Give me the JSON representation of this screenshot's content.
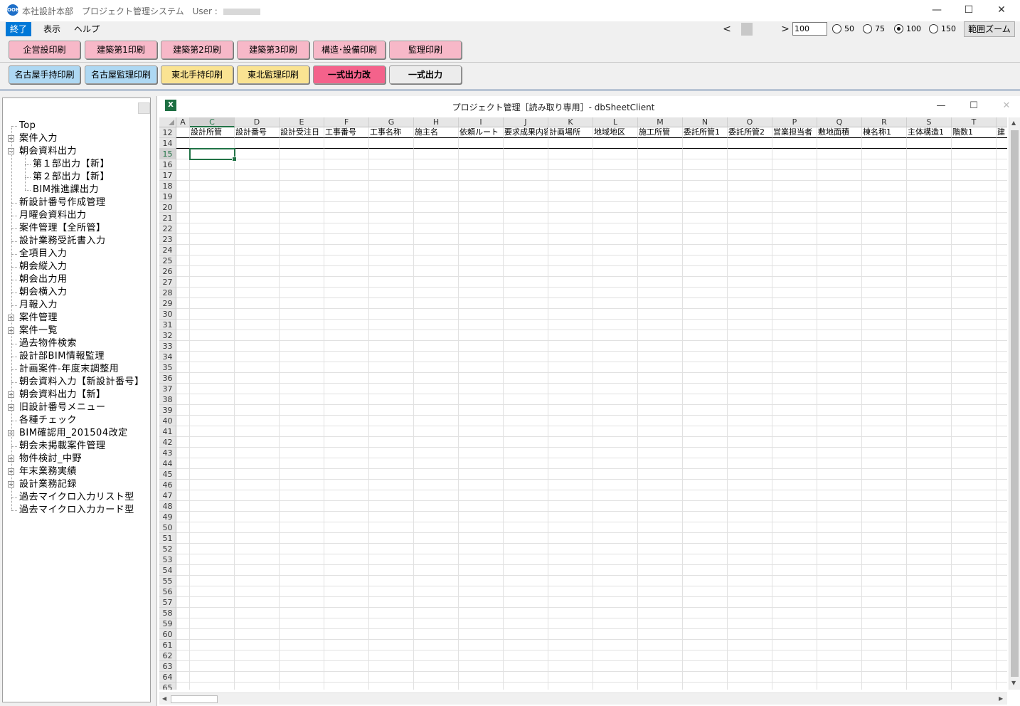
{
  "app": {
    "title_prefix": "本社設計本部　プロジェクト管理システム　User : ",
    "icon_text": "OOB"
  },
  "window_controls": {
    "minimize": "—",
    "maximize": "☐",
    "close": "✕"
  },
  "menu": [
    {
      "label": "終了",
      "active": true
    },
    {
      "label": "表示",
      "active": false
    },
    {
      "label": "ヘルプ",
      "active": false
    }
  ],
  "zoom": {
    "prev": "<",
    "next": ">",
    "value": "100",
    "options": [
      {
        "label": "50",
        "selected": false
      },
      {
        "label": "75",
        "selected": false
      },
      {
        "label": "100",
        "selected": true
      },
      {
        "label": "150",
        "selected": false
      }
    ],
    "range_zoom_label": "範囲ズーム"
  },
  "print_buttons": {
    "row1": [
      {
        "label": "企営設印刷",
        "color": "#f7b8c8"
      },
      {
        "label": "建築第1印刷",
        "color": "#f7b8c8"
      },
      {
        "label": "建築第2印刷",
        "color": "#f7b8c8"
      },
      {
        "label": "建築第3印刷",
        "color": "#f7b8c8"
      },
      {
        "label": "構造･設備印刷",
        "color": "#f7b8c8"
      },
      {
        "label": "監理印刷",
        "color": "#f7b8c8"
      }
    ],
    "row2": [
      {
        "label": "名古屋手持印刷",
        "color": "#aed8f3"
      },
      {
        "label": "名古屋監理印刷",
        "color": "#aed8f3"
      },
      {
        "label": "東北手持印刷",
        "color": "#fae392"
      },
      {
        "label": "東北監理印刷",
        "color": "#fae392"
      },
      {
        "label": "一式出力改",
        "color": "#f4628b"
      },
      {
        "label": "一式出力",
        "color": "#ececec"
      }
    ]
  },
  "tree": [
    {
      "label": "Top",
      "level": 0,
      "expander": "none"
    },
    {
      "label": "案件入力",
      "level": 0,
      "expander": "+"
    },
    {
      "label": "朝会資料出力",
      "level": 0,
      "expander": "-"
    },
    {
      "label": "第１部出力【新】",
      "level": 1,
      "expander": "none"
    },
    {
      "label": "第２部出力【新】",
      "level": 1,
      "expander": "none"
    },
    {
      "label": "BIM推進課出力",
      "level": 1,
      "expander": "none"
    },
    {
      "label": "新設計番号作成管理",
      "level": 0,
      "expander": "none"
    },
    {
      "label": "月曜会資料出力",
      "level": 0,
      "expander": "none"
    },
    {
      "label": "案件管理【全所管】",
      "level": 0,
      "expander": "none"
    },
    {
      "label": "設計業務受託書入力",
      "level": 0,
      "expander": "none"
    },
    {
      "label": "全項目入力",
      "level": 0,
      "expander": "none"
    },
    {
      "label": "朝会縦入力",
      "level": 0,
      "expander": "none"
    },
    {
      "label": "朝会出力用",
      "level": 0,
      "expander": "none"
    },
    {
      "label": "朝会横入力",
      "level": 0,
      "expander": "none"
    },
    {
      "label": "月報入力",
      "level": 0,
      "expander": "none"
    },
    {
      "label": "案件管理",
      "level": 0,
      "expander": "+"
    },
    {
      "label": "案件一覧",
      "level": 0,
      "expander": "+"
    },
    {
      "label": "過去物件検索",
      "level": 0,
      "expander": "none"
    },
    {
      "label": "設計部BIM情報監理",
      "level": 0,
      "expander": "none"
    },
    {
      "label": "計画案件-年度末調整用",
      "level": 0,
      "expander": "none"
    },
    {
      "label": "朝会資料入力【新設計番号】",
      "level": 0,
      "expander": "none"
    },
    {
      "label": "朝会資料出力【新】",
      "level": 0,
      "expander": "+"
    },
    {
      "label": "旧設計番号メニュー",
      "level": 0,
      "expander": "+"
    },
    {
      "label": "各種チェック",
      "level": 0,
      "expander": "none"
    },
    {
      "label": "BIM確認用_201504改定",
      "level": 0,
      "expander": "+"
    },
    {
      "label": "朝会未掲載案件管理",
      "level": 0,
      "expander": "none"
    },
    {
      "label": "物件検討_中野",
      "level": 0,
      "expander": "+"
    },
    {
      "label": "年末業務実績",
      "level": 0,
      "expander": "+"
    },
    {
      "label": "設計業務記録",
      "level": 0,
      "expander": "+"
    },
    {
      "label": "過去マイクロ入力リスト型",
      "level": 0,
      "expander": "none"
    },
    {
      "label": "過去マイクロ入力カード型",
      "level": 0,
      "expander": "none"
    }
  ],
  "excel": {
    "caption": "プロジェクト管理［読み取り専用］- dbSheetClient",
    "icon_text": "X",
    "columns": [
      "A",
      "C",
      "D",
      "E",
      "F",
      "G",
      "H",
      "I",
      "J",
      "K",
      "L",
      "M",
      "N",
      "O",
      "P",
      "Q",
      "R",
      "S",
      "T"
    ],
    "selected_column": "C",
    "header_row_number": "12",
    "header_cells": [
      "",
      "設計所管",
      "設計番号",
      "設計受注日",
      "工事番号",
      "工事名称",
      "施主名",
      "依頼ルート",
      "要求成果内容",
      "計画場所",
      "地域地区",
      "施工所管",
      "委託所管1",
      "委託所管2",
      "営業担当者",
      "敷地面積",
      "棟名称1",
      "主体構造1",
      "階数1",
      "建"
    ],
    "row_numbers": [
      "14",
      "15",
      "16",
      "17",
      "18",
      "19",
      "20",
      "21",
      "22",
      "23",
      "24",
      "25",
      "26",
      "27",
      "28",
      "29",
      "30",
      "31",
      "32",
      "33",
      "34",
      "35",
      "36",
      "37",
      "38",
      "39",
      "40",
      "41",
      "42",
      "43",
      "44",
      "45",
      "46",
      "47",
      "48",
      "49",
      "50",
      "51",
      "52",
      "53",
      "54",
      "55",
      "56",
      "57",
      "58",
      "59",
      "60",
      "61",
      "62",
      "63",
      "64",
      "65"
    ],
    "selected_row": "15"
  }
}
